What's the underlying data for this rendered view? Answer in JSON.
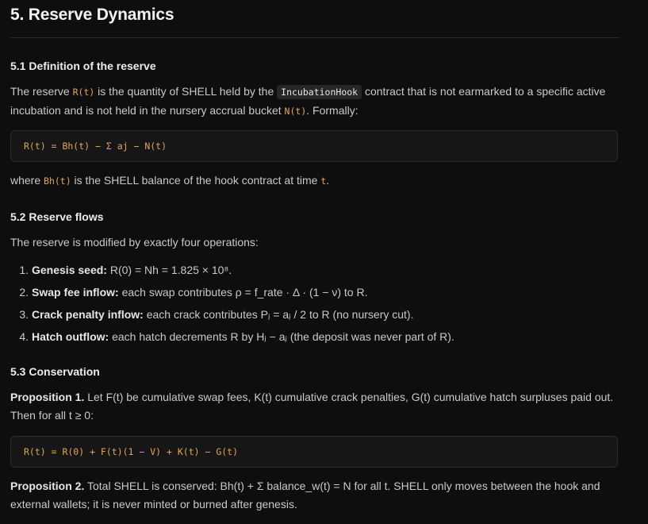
{
  "heading": "5. Reserve Dynamics",
  "s51": {
    "title": "5.1 Definition of the reserve",
    "p1_a": "The reserve ",
    "p1_code1": "R(t)",
    "p1_b": " is the quantity of SHELL held by the ",
    "p1_code2": "IncubationHook",
    "p1_c": " contract that is not earmarked to a specific active incubation and is not held in the nursery accrual bucket ",
    "p1_code3": "N(t)",
    "p1_d": ". Formally:",
    "formula": "R(t) = Bh(t) − Σ aj − N(t)",
    "p2_a": "where ",
    "p2_code1": "Bh(t)",
    "p2_b": " is the SHELL balance of the hook contract at time ",
    "p2_code2": "t",
    "p2_c": "."
  },
  "s52": {
    "title": "5.2 Reserve flows",
    "intro": "The reserve is modified by exactly four operations:",
    "items": [
      {
        "num": "1.",
        "label": "Genesis seed:",
        "text": " R(0) = Nh = 1.825 × 10⁸."
      },
      {
        "num": "2.",
        "label": "Swap fee inflow:",
        "text": " each swap contributes ρ = f_rate · Δ · (1 − ν) to R."
      },
      {
        "num": "3.",
        "label": "Crack penalty inflow:",
        "text": " each crack contributes Pⱼ = aⱼ / 2 to R (no nursery cut)."
      },
      {
        "num": "4.",
        "label": "Hatch outflow:",
        "text": " each hatch decrements R by Hⱼ − aⱼ (the deposit was never part of R)."
      }
    ]
  },
  "s53": {
    "title": "5.3 Conservation",
    "prop1_label": "Proposition 1.",
    "prop1_text": " Let F(t) be cumulative swap fees, K(t) cumulative crack penalties, G(t) cumulative hatch surpluses paid out. Then for all t ≥ 0:",
    "formula": "R(t) = R(0) + F(t)(1 − V) + K(t) − G(t)",
    "prop2_label": "Proposition 2.",
    "prop2_text": " Total SHELL is conserved: Bh(t) + Σ balance_w(t) = N for all t. SHELL only moves between the hook and external wallets; it is never minted or burned after genesis."
  }
}
